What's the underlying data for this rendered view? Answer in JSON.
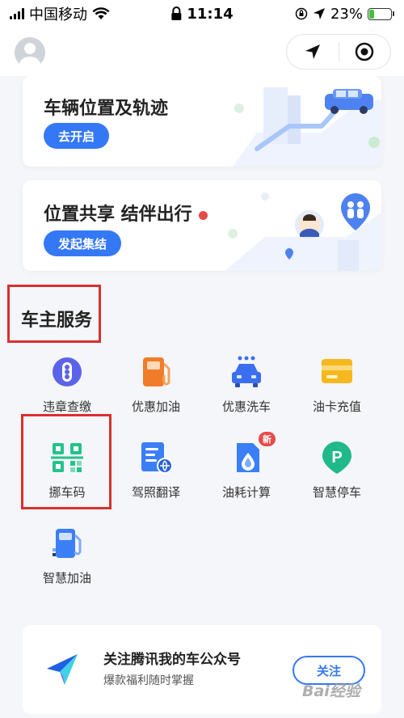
{
  "status_bar": {
    "carrier": "中国移动",
    "time": "11:14",
    "battery_percent": "23%",
    "battery_level": 0.23
  },
  "nav": {
    "avatar_icon": "user-avatar-icon",
    "location_icon": "navigation-arrow-icon",
    "close_icon": "target-circle-icon"
  },
  "cards": {
    "vehicle": {
      "title": "车辆位置及轨迹",
      "button": "去开启"
    },
    "share": {
      "title": "位置共享 结伴出行",
      "button": "发起集结"
    }
  },
  "services": {
    "title": "车主服务",
    "items": [
      {
        "label": "违章查缴",
        "icon": "traffic-light-icon",
        "color": "#5b63e8"
      },
      {
        "label": "优惠加油",
        "icon": "fuel-pump-icon",
        "color": "#f07c2a"
      },
      {
        "label": "优惠洗车",
        "icon": "car-wash-icon",
        "color": "#3b6ff0"
      },
      {
        "label": "油卡充值",
        "icon": "fuel-card-icon",
        "color": "#f5b81e"
      },
      {
        "label": "挪车码",
        "icon": "qr-code-icon",
        "color": "#25c28a"
      },
      {
        "label": "驾照翻译",
        "icon": "license-translate-icon",
        "color": "#3a7ff6"
      },
      {
        "label": "油耗计算",
        "icon": "fuel-drop-icon",
        "color": "#3a7ff6",
        "badge": "新"
      },
      {
        "label": "智慧停车",
        "icon": "parking-icon",
        "color": "#1fb98a"
      },
      {
        "label": "智慧加油",
        "icon": "smart-fuel-icon",
        "color": "#3a7ff6"
      }
    ]
  },
  "promo": {
    "title": "关注腾讯我的车公众号",
    "subtitle": "爆款福利随时掌握",
    "button": "关注",
    "logo_icon": "tencent-car-logo-icon"
  },
  "watermark": "Bai经验"
}
